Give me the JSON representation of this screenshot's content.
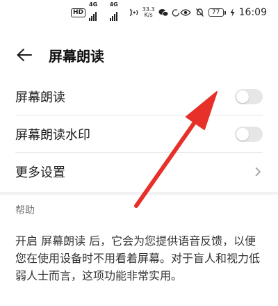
{
  "status_bar": {
    "hd": "HD",
    "net_a": "4G",
    "net_b": "4G",
    "speed_value": "33.3",
    "speed_unit": "K/s",
    "battery": "77",
    "time": "16:09"
  },
  "header": {
    "title": "屏幕朗读"
  },
  "settings": [
    {
      "label": "屏幕朗读",
      "type": "switch",
      "on": false
    },
    {
      "label": "屏幕朗读水印",
      "type": "switch",
      "on": false
    },
    {
      "label": "更多设置",
      "type": "link"
    }
  ],
  "help": {
    "title": "帮助",
    "text": "开启 屏幕朗读 后，它会为您提供语音反馈，以便您在使用设备时不用看着屏幕。对于盲人和视力低弱人士而言，这项功能非常实用。"
  },
  "colors": {
    "annotation_arrow": "#e8302a",
    "switch_off": "#e6e6e6",
    "divider": "#e6e6e6"
  }
}
